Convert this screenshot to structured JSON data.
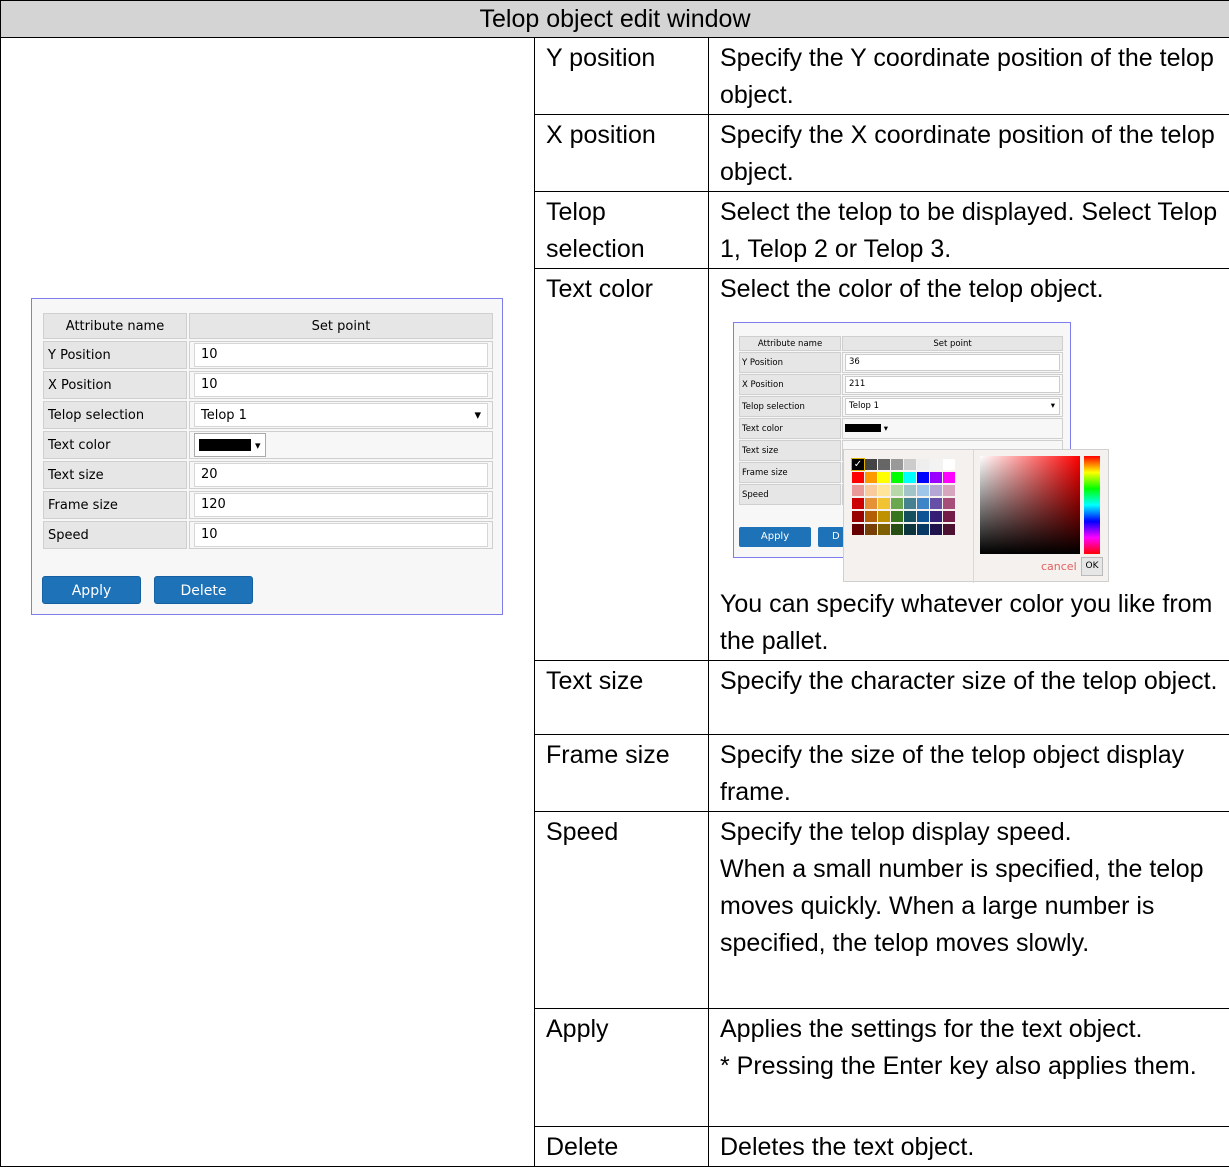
{
  "title": "Telop object edit window",
  "rows": [
    {
      "attr": "Y position",
      "desc": "Specify the Y coordinate position of the telop object."
    },
    {
      "attr": "X position",
      "desc": "Specify the X coordinate position of the telop object."
    },
    {
      "attr": "Telop selection",
      "desc": "Select the telop to be displayed. Select Telop 1, Telop 2 or Telop 3."
    },
    {
      "attr": "Text color",
      "desc": "Select the color of the telop object.",
      "desc_after": "You can specify whatever color you like from the pallet."
    },
    {
      "attr": "Text size",
      "desc": "Specify the character size of the telop object."
    },
    {
      "attr": "Frame size",
      "desc": "Specify the size of the telop object display frame."
    },
    {
      "attr": "Speed",
      "desc": "Specify the telop display speed.",
      "desc_line2": "When a small number is specified, the telop moves quickly. When a large number is specified, the telop moves slowly."
    },
    {
      "attr": "Apply",
      "desc": "Applies the settings for the text object.",
      "desc_line2": "* Pressing the Enter key also applies them."
    },
    {
      "attr": "Delete",
      "desc": "Deletes the text object."
    }
  ],
  "panel": {
    "header_attr": "Attribute name",
    "header_value": "Set point",
    "fields": [
      {
        "label": "Y Position",
        "value": "10"
      },
      {
        "label": "X Position",
        "value": "10"
      },
      {
        "label": "Telop selection",
        "value": "Telop 1"
      },
      {
        "label": "Text color",
        "value": ""
      },
      {
        "label": "Text size",
        "value": "20"
      },
      {
        "label": "Frame size",
        "value": "120"
      },
      {
        "label": "Speed",
        "value": "10"
      }
    ],
    "apply_label": "Apply",
    "delete_label": "Delete",
    "selected_color": "#000000"
  },
  "mini_panel": {
    "header_attr": "Attribute name",
    "header_value": "Set point",
    "fields": [
      {
        "label": "Y Position",
        "value": "36"
      },
      {
        "label": "X Position",
        "value": "211"
      },
      {
        "label": "Telop selection",
        "value": "Telop 1"
      },
      {
        "label": "Text color",
        "value": ""
      },
      {
        "label": "Text size",
        "value": ""
      },
      {
        "label": "Frame size",
        "value": ""
      },
      {
        "label": "Speed",
        "value": ""
      }
    ],
    "apply_label": "Apply",
    "delete_label_visible": "D",
    "picker": {
      "cancel_label": "cancel",
      "ok_label": "OK",
      "palette": [
        "#000000",
        "#444444",
        "#666666",
        "#999999",
        "#cccccc",
        "#eeeeee",
        "#f3f3f3",
        "#ffffff",
        "#ff0000",
        "#ff9900",
        "#ffff00",
        "#00ff00",
        "#00ffff",
        "#0000ff",
        "#9900ff",
        "#ff00ff",
        "#ea9999",
        "#f9cb9c",
        "#ffe599",
        "#b6d7a8",
        "#a2c4c9",
        "#9fc5e8",
        "#b4a7d6",
        "#d5a6bd",
        "#cc0000",
        "#e69138",
        "#f1c232",
        "#6aa84f",
        "#45818e",
        "#3d85c6",
        "#674ea7",
        "#a64d79",
        "#990000",
        "#b45f06",
        "#bf9000",
        "#38761d",
        "#134f5c",
        "#0b5394",
        "#351c75",
        "#741b47",
        "#660000",
        "#783f04",
        "#7f6000",
        "#274e13",
        "#0c343d",
        "#073763",
        "#20124d",
        "#4c1130"
      ]
    }
  }
}
